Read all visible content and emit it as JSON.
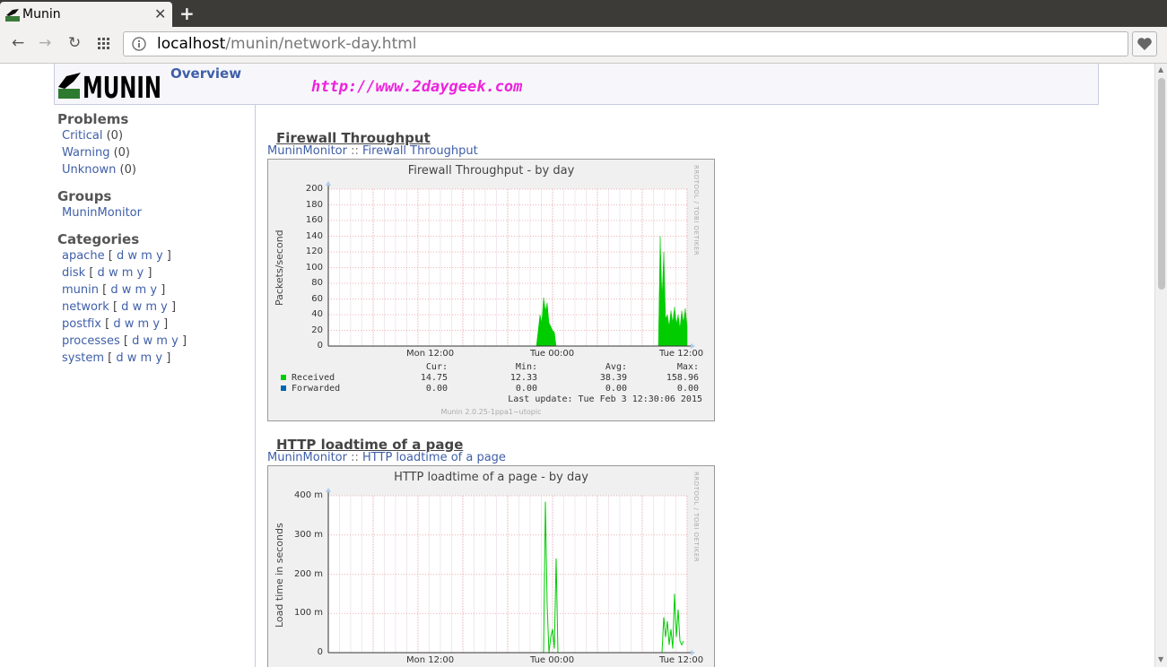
{
  "browser": {
    "tab_title": "Munin",
    "url_host": "localhost",
    "url_path": "/munin/network-day.html"
  },
  "header": {
    "logo_text": "MUNIN",
    "overview": "Overview",
    "watermark": "http://www.2daygeek.com"
  },
  "sidebar": {
    "problems_heading": "Problems",
    "problems": [
      {
        "label": "Critical",
        "count": "(0)"
      },
      {
        "label": "Warning",
        "count": "(0)"
      },
      {
        "label": "Unknown",
        "count": "(0)"
      }
    ],
    "groups_heading": "Groups",
    "groups": [
      "MuninMonitor"
    ],
    "categories_heading": "Categories",
    "categories": [
      "apache",
      "disk",
      "munin",
      "network",
      "postfix",
      "processes",
      "system"
    ],
    "period_links": [
      "d",
      "w",
      "m",
      "y"
    ]
  },
  "sections": [
    {
      "title": "Firewall Throughput",
      "crumb_group": "MuninMonitor",
      "crumb_sep": "::",
      "crumb_item": "Firewall Throughput"
    },
    {
      "title": "HTTP loadtime of a page",
      "crumb_group": "MuninMonitor",
      "crumb_sep": "::",
      "crumb_item": "HTTP loadtime of a page"
    }
  ],
  "graph_side_text": "RRDTOOL / TOBI OETIKER",
  "chart_data": [
    {
      "type": "area",
      "title": "Firewall Throughput - by day",
      "ylabel": "Packets/second",
      "ylim": [
        0,
        200
      ],
      "yticks": [
        "200",
        "180",
        "160",
        "140",
        "120",
        "100",
        "80",
        "60",
        "40",
        "20",
        "0"
      ],
      "xticks": [
        "Mon 12:00",
        "Tue 00:00",
        "Tue 12:00"
      ],
      "grid": true,
      "series": [
        {
          "name": "Received",
          "color": "#00cc00",
          "x": [
            0.58,
            0.59,
            0.595,
            0.6,
            0.605,
            0.61,
            0.615,
            0.62,
            0.625,
            0.63,
            0.635,
            0.64,
            0.92,
            0.925,
            0.93,
            0.935,
            0.94,
            0.945,
            0.95,
            0.955,
            0.96,
            0.965,
            0.97,
            0.975,
            0.98,
            0.985,
            0.99,
            0.995,
            1.0
          ],
          "values": [
            0,
            40,
            30,
            62,
            45,
            55,
            30,
            25,
            20,
            18,
            0,
            0,
            0,
            140,
            60,
            120,
            35,
            40,
            25,
            45,
            30,
            50,
            28,
            40,
            22,
            45,
            30,
            48,
            25
          ]
        },
        {
          "name": "Forwarded",
          "color": "#0066b3",
          "x": [],
          "values": []
        }
      ],
      "legend": {
        "headers": [
          "Cur:",
          "Min:",
          "Avg:",
          "Max:"
        ],
        "rows": [
          {
            "name": "Received",
            "color": "#00cc00",
            "cur": "14.75",
            "min": "12.33",
            "avg": "38.39",
            "max": "158.96"
          },
          {
            "name": "Forwarded",
            "color": "#0066b3",
            "cur": "0.00",
            "min": "0.00",
            "avg": "0.00",
            "max": "0.00"
          }
        ],
        "last_update": "Last update:  Tue Feb  3 12:30:06 2015",
        "version": "Munin 2.0.25-1ppa1~utopic"
      }
    },
    {
      "type": "line",
      "title": "HTTP loadtime of a page - by day",
      "ylabel": "Load time in seconds",
      "ylim": [
        0,
        400
      ],
      "yticks": [
        "400 m",
        "300 m",
        "200 m",
        "100 m",
        "0"
      ],
      "xticks": [
        "Mon 12:00",
        "Tue 00:00",
        "Tue 12:00"
      ],
      "grid": true,
      "series": [
        {
          "name": "",
          "color": "#00cc00",
          "x": [
            0.6,
            0.605,
            0.61,
            0.615,
            0.62,
            0.625,
            0.63,
            0.635,
            0.64,
            0.645,
            0.65,
            0.655,
            0.93,
            0.935,
            0.94,
            0.945,
            0.95,
            0.955,
            0.96,
            0.965,
            0.97,
            0.975,
            0.98,
            0.985,
            0.99
          ],
          "values": [
            0,
            385,
            120,
            0,
            40,
            60,
            10,
            240,
            0,
            0,
            0,
            0,
            0,
            90,
            40,
            80,
            20,
            60,
            10,
            150,
            40,
            110,
            30,
            20,
            30
          ]
        }
      ]
    }
  ]
}
